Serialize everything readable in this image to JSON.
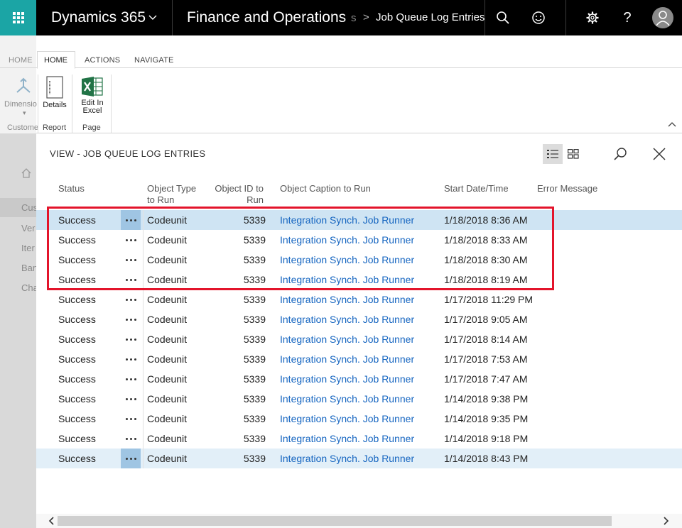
{
  "topbar": {
    "product": "Dynamics 365",
    "module": "Finance and Operations",
    "breadcrumb_fragment": "s",
    "breadcrumb_separator": ">",
    "page": "Job Queue Log Entries",
    "help_label": "?"
  },
  "ribbon": {
    "tabs": {
      "home_dim": "HOME",
      "home": "HOME",
      "actions": "ACTIONS",
      "navigate": "NAVIGATE"
    },
    "buttons": {
      "dimensions": "Dimensio",
      "details": "Details",
      "edit_in_excel_line1": "Edit In",
      "edit_in_excel_line2": "Excel"
    },
    "groups": {
      "customer": "Custome",
      "report": "Report",
      "page": "Page"
    }
  },
  "background_page": {
    "items": [
      "Cus",
      "Ver",
      "Iter",
      "Ban",
      "Cha"
    ]
  },
  "panel": {
    "title": "VIEW - JOB QUEUE LOG ENTRIES",
    "columns": {
      "status": "Status",
      "object_type_line1": "Object Type",
      "object_type_line2": "to Run",
      "object_id_line1": "Object ID to",
      "object_id_line2": "Run",
      "caption": "Object Caption to Run",
      "start": "Start Date/Time",
      "error": "Error Message"
    },
    "rows": [
      {
        "status": "Success",
        "type": "Codeunit",
        "id": "5339",
        "caption": "Integration Synch. Job Runner",
        "start": "1/18/2018 8:36 AM"
      },
      {
        "status": "Success",
        "type": "Codeunit",
        "id": "5339",
        "caption": "Integration Synch. Job Runner",
        "start": "1/18/2018 8:33 AM"
      },
      {
        "status": "Success",
        "type": "Codeunit",
        "id": "5339",
        "caption": "Integration Synch. Job Runner",
        "start": "1/18/2018 8:30 AM"
      },
      {
        "status": "Success",
        "type": "Codeunit",
        "id": "5339",
        "caption": "Integration Synch. Job Runner",
        "start": "1/18/2018 8:19 AM"
      },
      {
        "status": "Success",
        "type": "Codeunit",
        "id": "5339",
        "caption": "Integration Synch. Job Runner",
        "start": "1/17/2018 11:29 PM"
      },
      {
        "status": "Success",
        "type": "Codeunit",
        "id": "5339",
        "caption": "Integration Synch. Job Runner",
        "start": "1/17/2018 9:05 AM"
      },
      {
        "status": "Success",
        "type": "Codeunit",
        "id": "5339",
        "caption": "Integration Synch. Job Runner",
        "start": "1/17/2018 8:14 AM"
      },
      {
        "status": "Success",
        "type": "Codeunit",
        "id": "5339",
        "caption": "Integration Synch. Job Runner",
        "start": "1/17/2018 7:53 AM"
      },
      {
        "status": "Success",
        "type": "Codeunit",
        "id": "5339",
        "caption": "Integration Synch. Job Runner",
        "start": "1/17/2018 7:47 AM"
      },
      {
        "status": "Success",
        "type": "Codeunit",
        "id": "5339",
        "caption": "Integration Synch. Job Runner",
        "start": "1/14/2018 9:38 PM"
      },
      {
        "status": "Success",
        "type": "Codeunit",
        "id": "5339",
        "caption": "Integration Synch. Job Runner",
        "start": "1/14/2018 9:35 PM"
      },
      {
        "status": "Success",
        "type": "Codeunit",
        "id": "5339",
        "caption": "Integration Synch. Job Runner",
        "start": "1/14/2018 9:18 PM"
      },
      {
        "status": "Success",
        "type": "Codeunit",
        "id": "5339",
        "caption": "Integration Synch. Job Runner",
        "start": "1/14/2018 8:43 PM"
      }
    ]
  },
  "colors": {
    "nav_bg": "#000000",
    "waffle_bg": "#1ba5a5",
    "link": "#1565c0",
    "selected_row": "#cfe4f3",
    "annotation_red": "#e3142b"
  }
}
